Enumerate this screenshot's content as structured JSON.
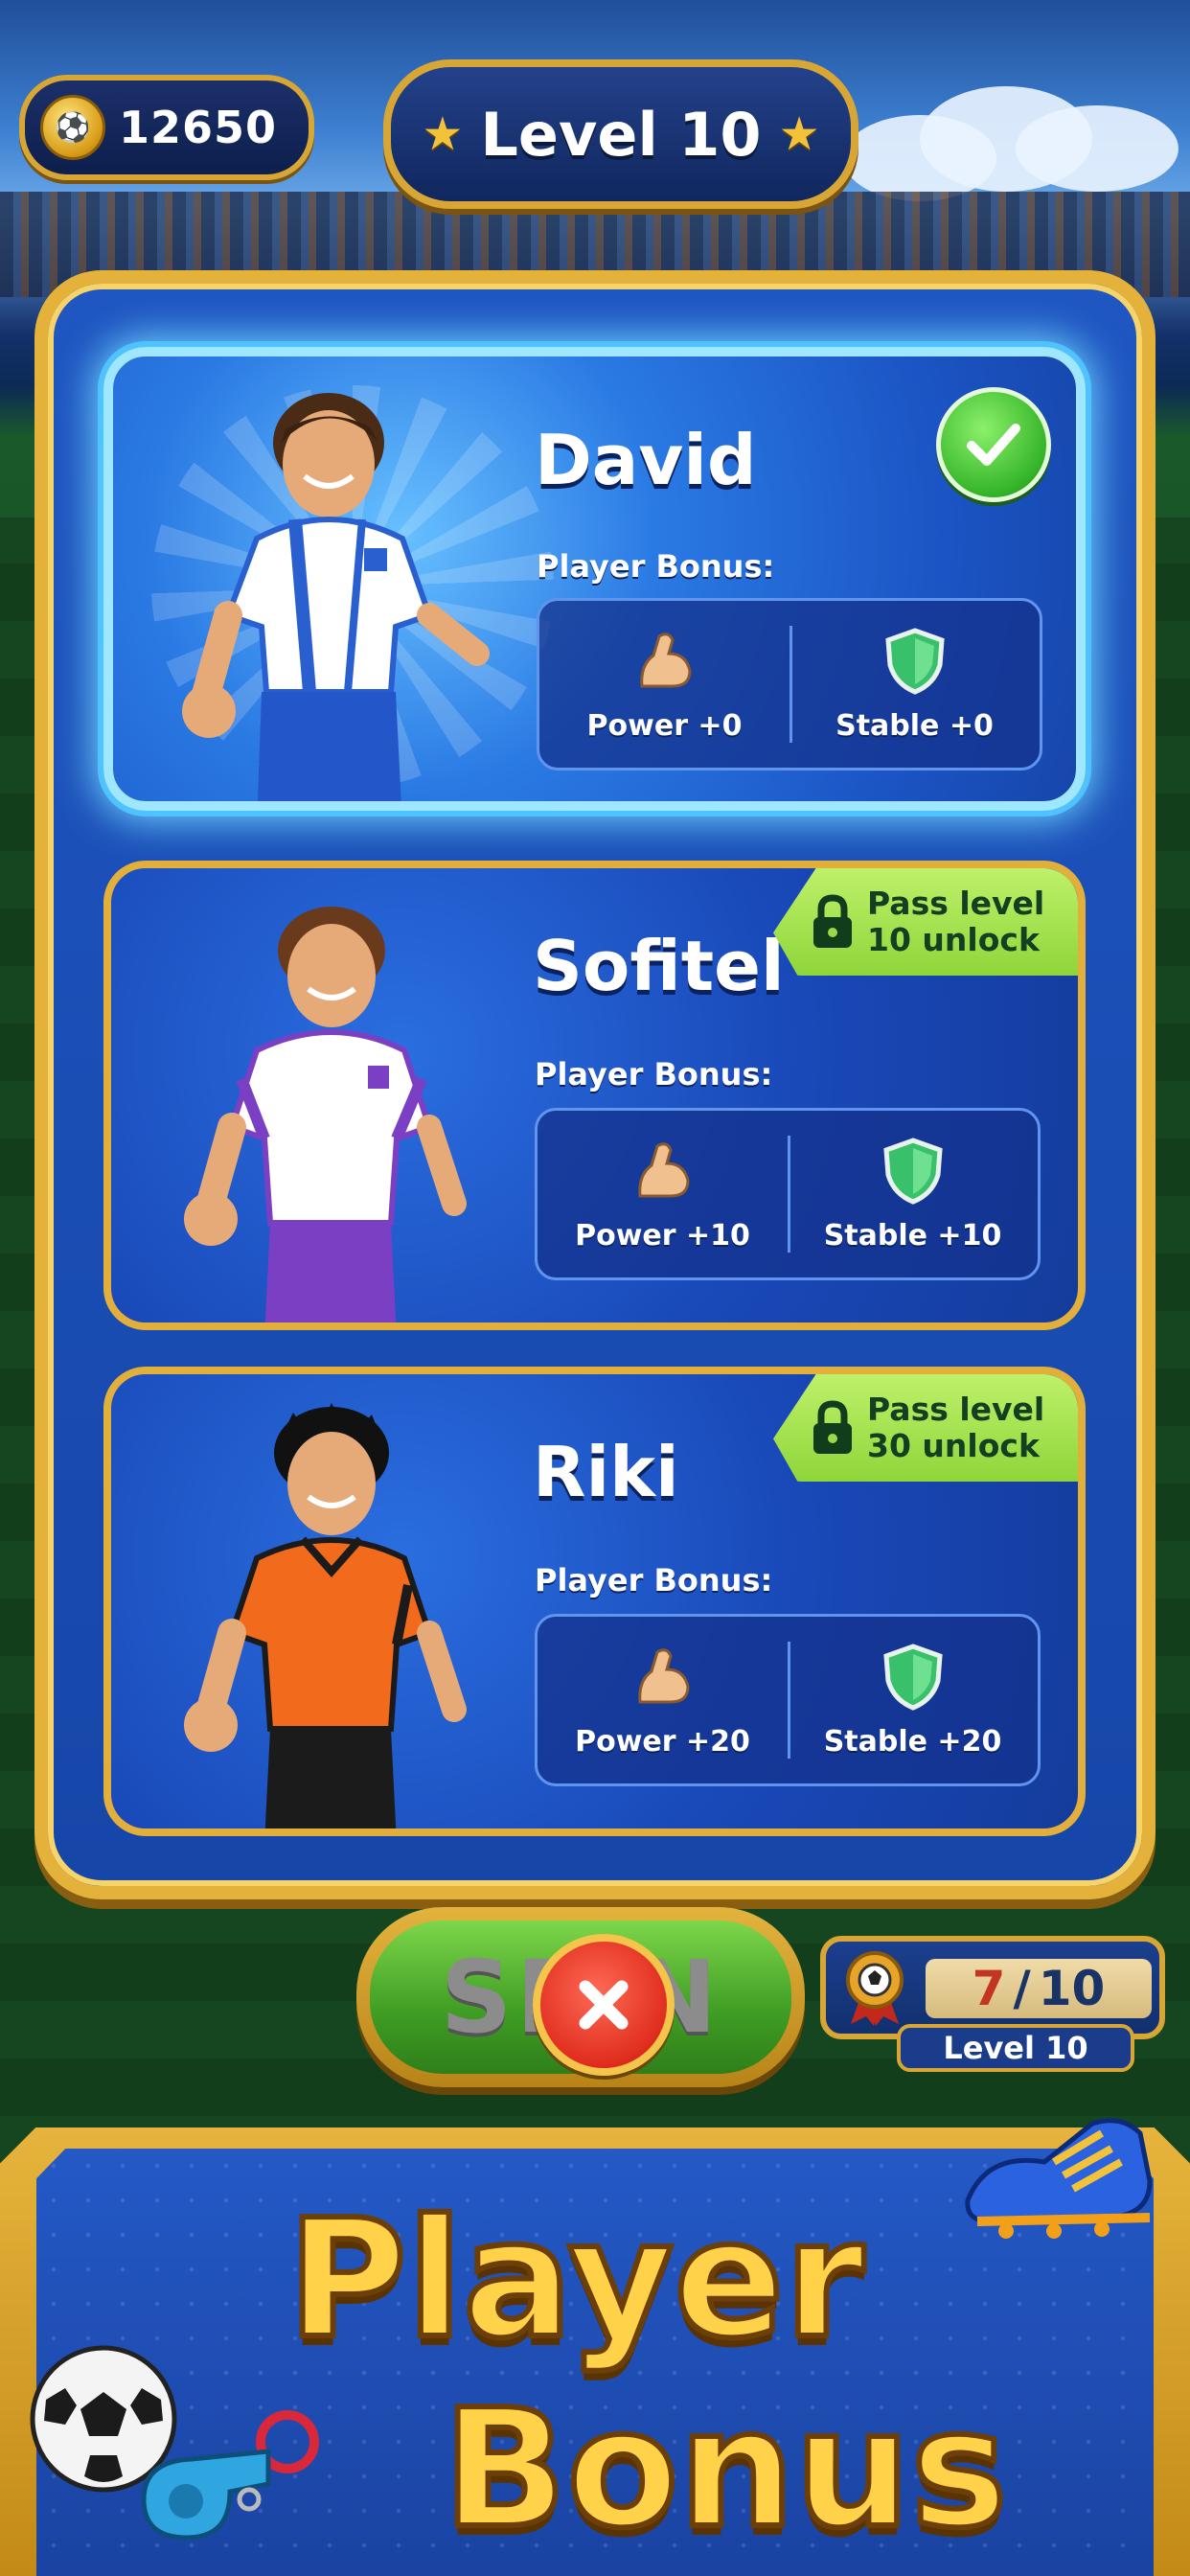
{
  "topbar": {
    "coins": "12650",
    "level": "Level 10"
  },
  "players": [
    {
      "name": "David",
      "bonus_label": "Player Bonus:",
      "power": "Power +0",
      "stable": "Stable +0",
      "selected": true,
      "jersey_colors": [
        "#ffffff",
        "#2a5fd0"
      ]
    },
    {
      "name": "Sofitel",
      "bonus_label": "Player Bonus:",
      "power": "Power +10",
      "stable": "Stable +10",
      "lock_line1": "Pass level",
      "lock_line2": "10 unlock",
      "jersey_colors": [
        "#ffffff",
        "#7b3fc4"
      ]
    },
    {
      "name": "Riki",
      "bonus_label": "Player Bonus:",
      "power": "Power +20",
      "stable": "Stable +20",
      "lock_line1": "Pass level",
      "lock_line2": "30 unlock",
      "jersey_colors": [
        "#f26a1b",
        "#1b1b1b"
      ]
    }
  ],
  "spin": {
    "label": "SPIN"
  },
  "progress": {
    "current": "7",
    "separator": "/",
    "max": "10",
    "level": "Level 10"
  },
  "banner": {
    "line1": "Player",
    "line2": "Bonus"
  },
  "colors": {
    "gold": "#e4b23a",
    "panel_blue": "#1f56c2",
    "lock_green": "#9ad94a",
    "check_green": "#35b52a"
  }
}
